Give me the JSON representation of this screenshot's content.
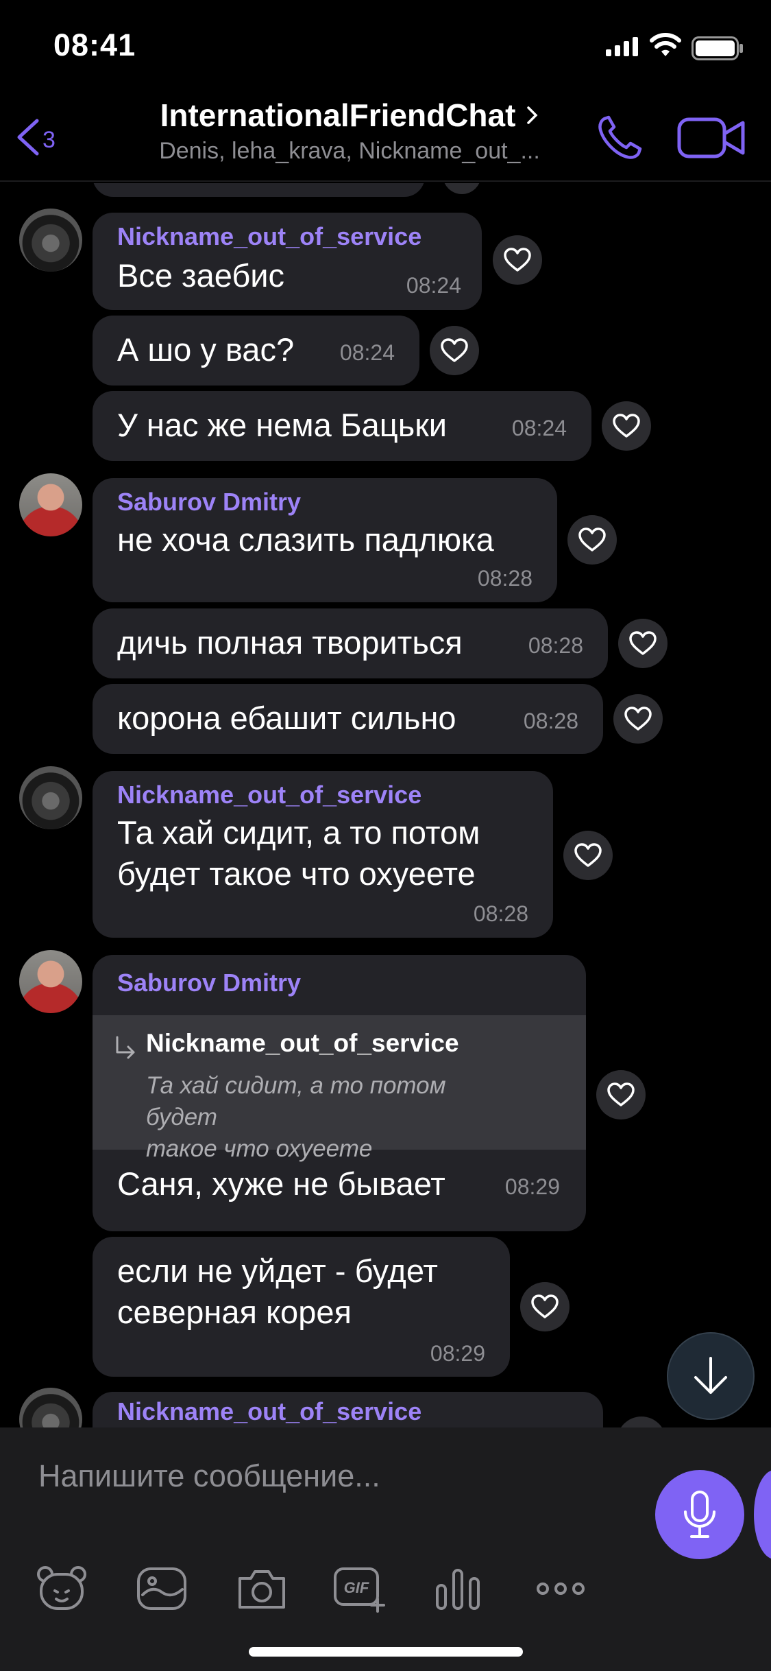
{
  "status_bar": {
    "time": "08:41"
  },
  "header": {
    "back_count": "3",
    "title": "InternationalFriendChat",
    "subtitle": "Denis, leha_krava, Nickname_out_..."
  },
  "messages": [
    {
      "sender": "Nickname_out_of_service",
      "text": "Все заебис",
      "time": "08:24"
    },
    {
      "text": "А шо у вас?",
      "time": "08:24"
    },
    {
      "text": "У нас же нема Бацьки",
      "time": "08:24"
    },
    {
      "sender": "Saburov Dmitry",
      "text": "не хоча слазить падлюка",
      "time": "08:28"
    },
    {
      "text": "дичь полная твориться",
      "time": "08:28"
    },
    {
      "text": "корона ебашит сильно",
      "time": "08:28"
    },
    {
      "sender": "Nickname_out_of_service",
      "text_lines": [
        "Та хай сидит, а то потом",
        "будет такое что охуеете"
      ],
      "time": "08:28"
    },
    {
      "sender": "Saburov Dmitry",
      "reply_to": {
        "author": "Nickname_out_of_service",
        "text_lines": [
          "Та хай сидит, а то потом будет",
          "такое что охуеете"
        ]
      },
      "text": "Саня, хуже не бывает",
      "time": "08:29"
    },
    {
      "text_lines": [
        "если не уйдет - будет",
        "северная корея"
      ],
      "time": "08:29"
    },
    {
      "sender": "Nickname_out_of_service"
    }
  ],
  "composer": {
    "placeholder": "Напишите сообщение...",
    "toolbar": [
      "sticker-bear-icon",
      "doodle-icon",
      "camera-icon",
      "gif-icon",
      "poll-icon",
      "more-icon"
    ]
  },
  "colors": {
    "accent": "#7f63f4",
    "sender_name": "#9d83f7",
    "bubble": "#232328",
    "background": "#000000"
  }
}
